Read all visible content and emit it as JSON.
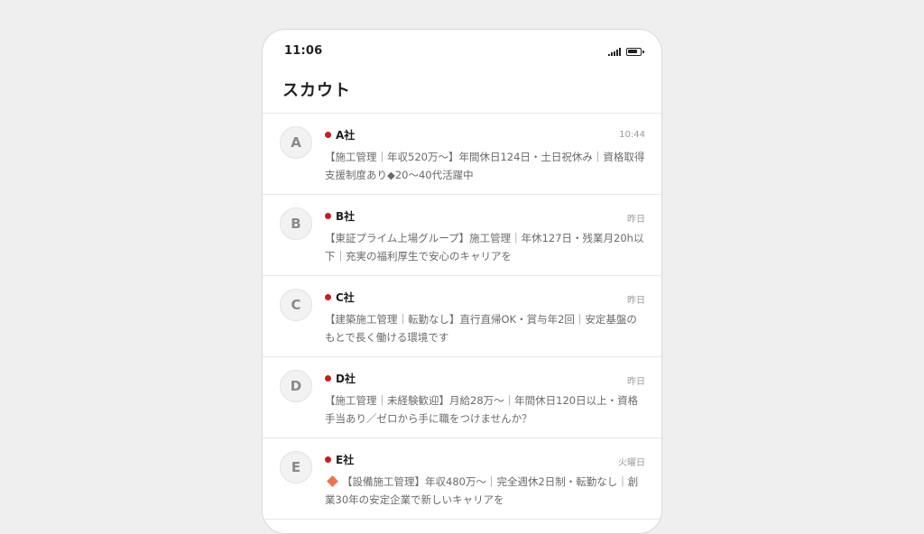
{
  "status_bar": {
    "time": "11:06",
    "icons": [
      "signal-icon",
      "battery-icon"
    ],
    "battery_level": 0.85
  },
  "header": {
    "title": "スカウト"
  },
  "colors": {
    "unread_dot": "#cc1b1b",
    "diamond_icon": "#ec7250"
  },
  "scouts": [
    {
      "avatar": "A",
      "company": "A社",
      "time": "10:44",
      "message": "【施工管理｜年収520万〜】年間休日124日・土日祝休み｜資格取得支援制度あり◆20〜40代活躍中",
      "unread": true
    },
    {
      "avatar": "B",
      "company": "B社",
      "time": "昨日",
      "message": "【東証プライム上場グループ】施工管理｜年休127日・残業月20h以下｜充実の福利厚生で安心のキャリアを",
      "unread": true
    },
    {
      "avatar": "C",
      "company": "C社",
      "time": "昨日",
      "message": "【建築施工管理｜転勤なし】直行直帰OK・賞与年2回｜安定基盤のもとで長く働ける環境です",
      "unread": true
    },
    {
      "avatar": "D",
      "company": "D社",
      "time": "昨日",
      "message": "【施工管理｜未経験歓迎】月給28万〜｜年間休日120日以上・資格手当あり／ゼロから手に職をつけませんか？",
      "unread": true
    },
    {
      "avatar": "E",
      "company": "E社",
      "time": "火曜日",
      "message": "【設備施工管理】年収480万〜｜完全週休2日制・転勤なし｜創業30年の安定企業で新しいキャリアを",
      "unread": true,
      "leading_icon": "diamond-icon"
    }
  ]
}
